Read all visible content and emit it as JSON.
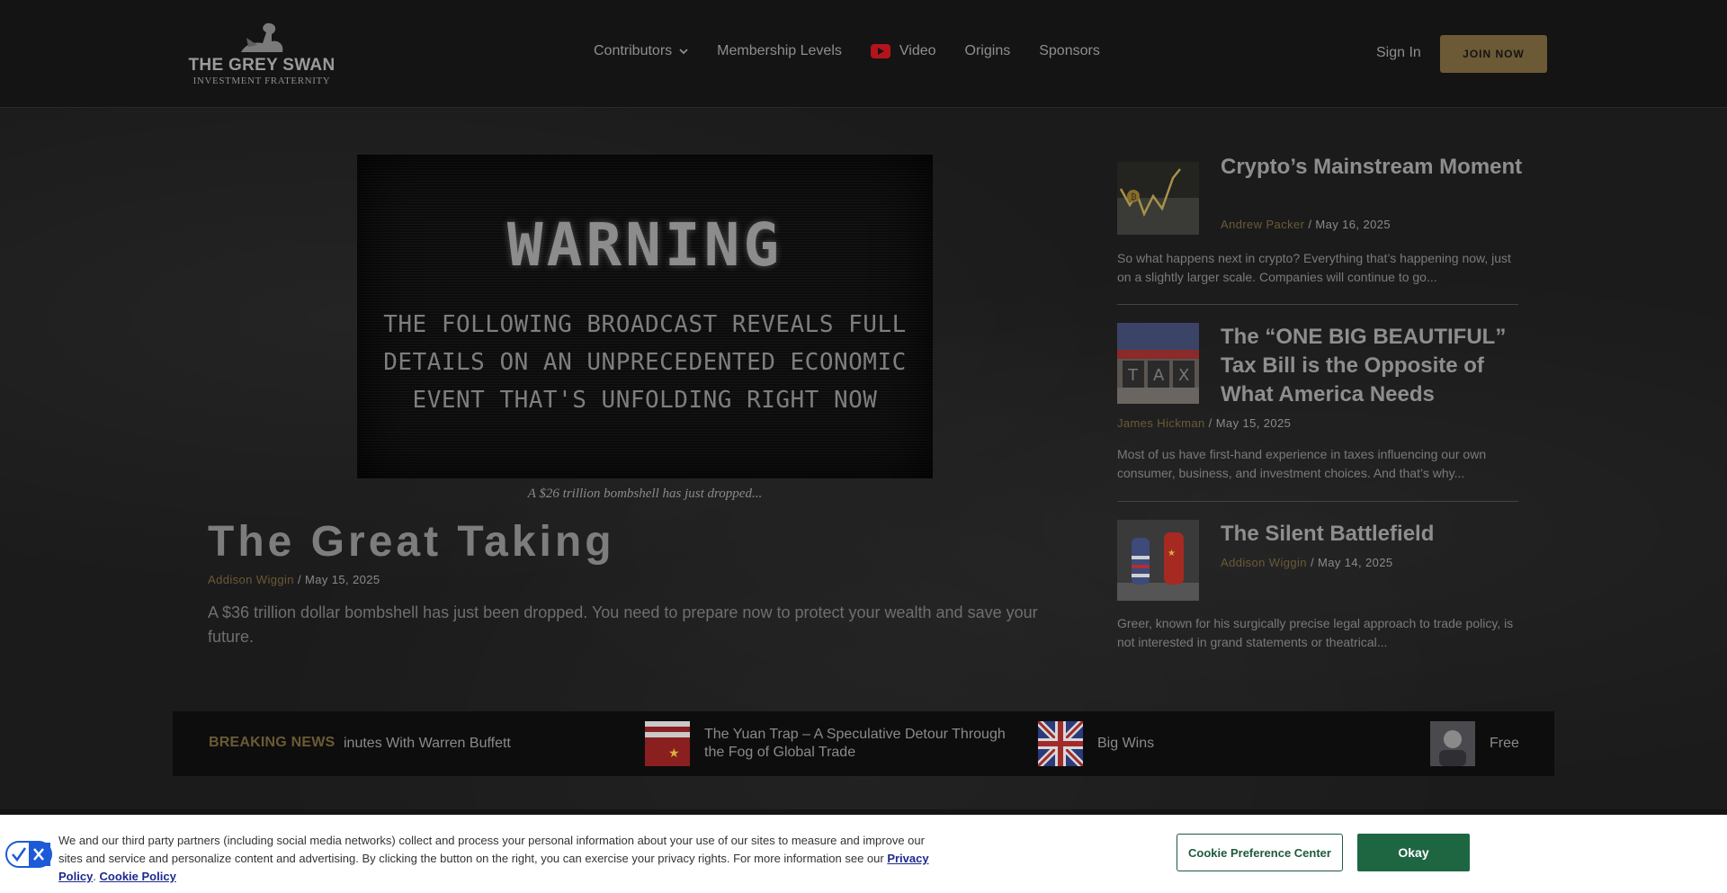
{
  "header": {
    "logo_title": "THE GREY SWAN",
    "logo_subtitle": "INVESTMENT FRATERNITY",
    "nav": [
      {
        "label": "Contributors"
      },
      {
        "label": "Membership Levels"
      },
      {
        "label": "Video"
      },
      {
        "label": "Origins"
      },
      {
        "label": "Sponsors"
      }
    ],
    "sign_in": "Sign In",
    "join_now": "JOIN NOW",
    "accent_color": "#6b5a35"
  },
  "hero": {
    "image_title": "WARNING",
    "image_line1": "THE FOLLOWING BROADCAST REVEALS FULL",
    "image_line2": "DETAILS ON AN UNPRECEDENTED ECONOMIC",
    "image_line3": "EVENT THAT'S UNFOLDING RIGHT NOW",
    "caption": "A $26 trillion bombshell has just dropped...",
    "title": "The Great Taking",
    "author": "Addison Wiggin",
    "date": " / May 15, 2025",
    "excerpt": "A $36 trillion dollar bombshell has just been dropped. You need to prepare now to protect your wealth and save your future."
  },
  "sidebar": [
    {
      "title": "Crypto’s Mainstream Moment",
      "author": "Andrew Packer",
      "date": " / May 16, 2025",
      "excerpt": "So what happens next in crypto? Everything that’s happening now, just on a slightly larger scale. Companies will continue to go...",
      "thumb_icon": "crypto-chart-icon"
    },
    {
      "title": "The “ONE BIG BEAUTIFUL” Tax Bill is the Opposite of What America Needs",
      "author": "James Hickman",
      "date": " / May 15, 2025",
      "excerpt": "Most of us have first-hand experience in taxes influencing our own consumer, business, and investment choices. And that’s why...",
      "thumb_icon": "tax-blocks-icon"
    },
    {
      "title": "The Silent Battlefield",
      "author": "Addison Wiggin",
      "date": " / May 14, 2025",
      "excerpt": "Greer, known for his surgically precise legal approach to trade policy, is not interested in grand statements or theatrical...",
      "thumb_icon": "chess-flags-icon"
    }
  ],
  "breaking": {
    "label": "BREAKING NEWS",
    "items": [
      {
        "text": "inutes With Warren Buffett"
      },
      {
        "text": "The Yuan Trap – A Speculative Detour Through the Fog of Global Trade"
      },
      {
        "text": "Big Wins"
      },
      {
        "text": "Free"
      }
    ]
  },
  "cookie": {
    "text": "We and our third party partners (including social media networks) collect and process your personal information about your use of our sites to measure and improve our sites and service and personalize content and advertising. By clicking the button on the right, you can exercise your privacy rights. For more information see our ",
    "privacy_link": "Privacy Policy",
    "separator": ".",
    "cookie_link": "Cookie Policy",
    "pref_button": "Cookie Preference Center",
    "ok_button": "Okay"
  }
}
